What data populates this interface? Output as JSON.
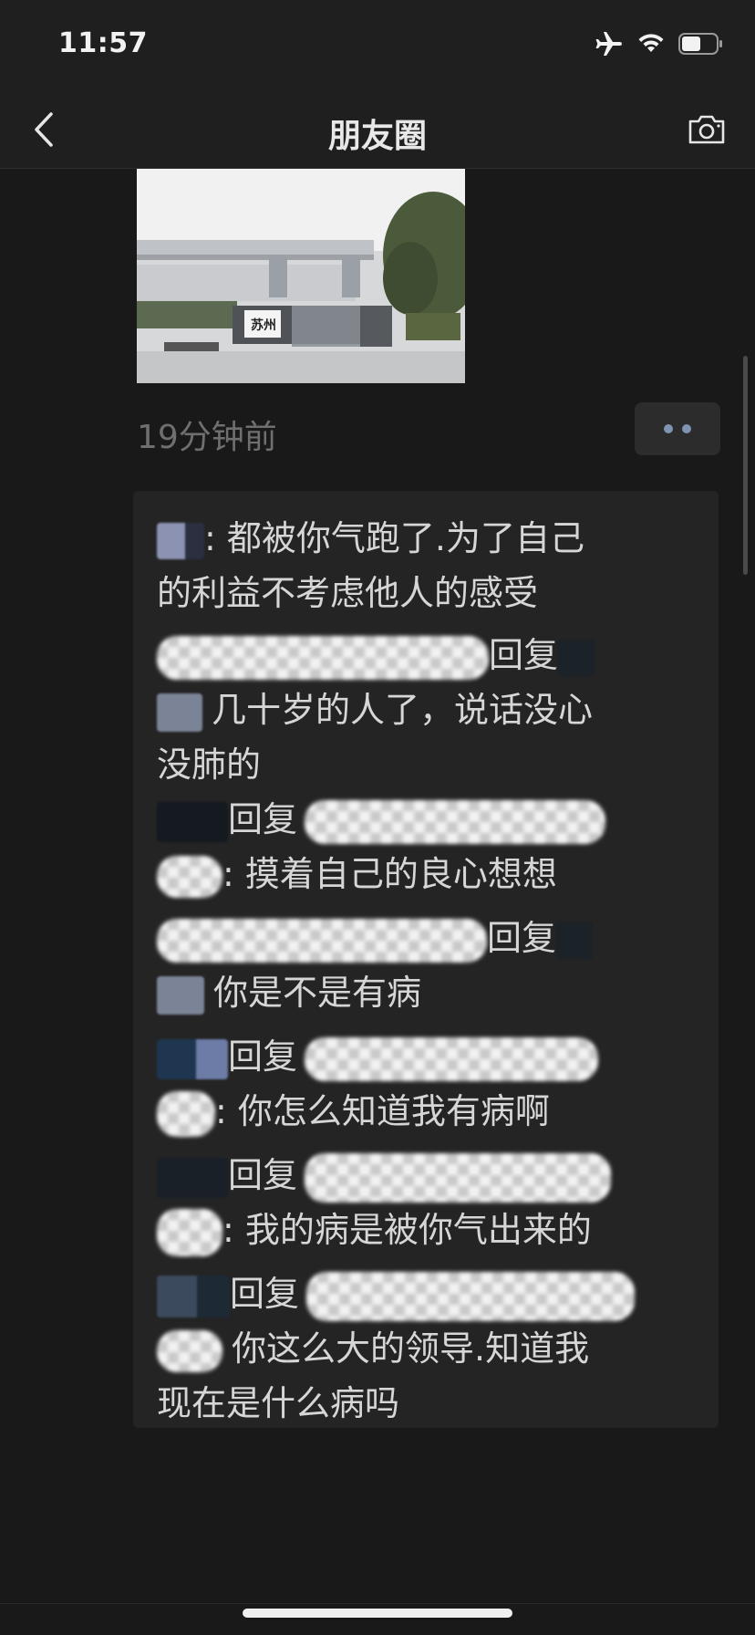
{
  "status": {
    "time": "11:57",
    "icons": [
      "airplane-icon",
      "wifi-icon",
      "battery-icon"
    ]
  },
  "nav": {
    "title": "朋友圈",
    "back_icon": "chevron-left-icon",
    "camera_icon": "camera-icon"
  },
  "post": {
    "photo_sign_text": "苏州",
    "time": "19分钟前",
    "more_icon": "more-dots-icon"
  },
  "comments": [
    {
      "lines": [
        ": 都被你气跑了.为了自己",
        "的利益不考虑他人的感受"
      ]
    },
    {
      "reply_word": "回复",
      "lines": [
        "几十岁的人了，说话没心",
        "没肺的"
      ]
    },
    {
      "reply_word": "回复",
      "lines": [
        ": 摸着自己的良心想想"
      ]
    },
    {
      "reply_word": "回复",
      "lines": [
        "你是不是有病"
      ]
    },
    {
      "reply_word": "回复",
      "lines": [
        ": 你怎么知道我有病啊"
      ]
    },
    {
      "reply_word": "回复",
      "lines": [
        ": 我的病是被你气出来的"
      ]
    },
    {
      "reply_word": "回复",
      "lines": [
        "你这么大的领导.知道我",
        "现在是什么病吗"
      ]
    }
  ],
  "colors": {
    "background": "#191919",
    "bar": "#1f1f1f",
    "comment_box": "#242424",
    "accent_dots": "#7f94b3"
  }
}
